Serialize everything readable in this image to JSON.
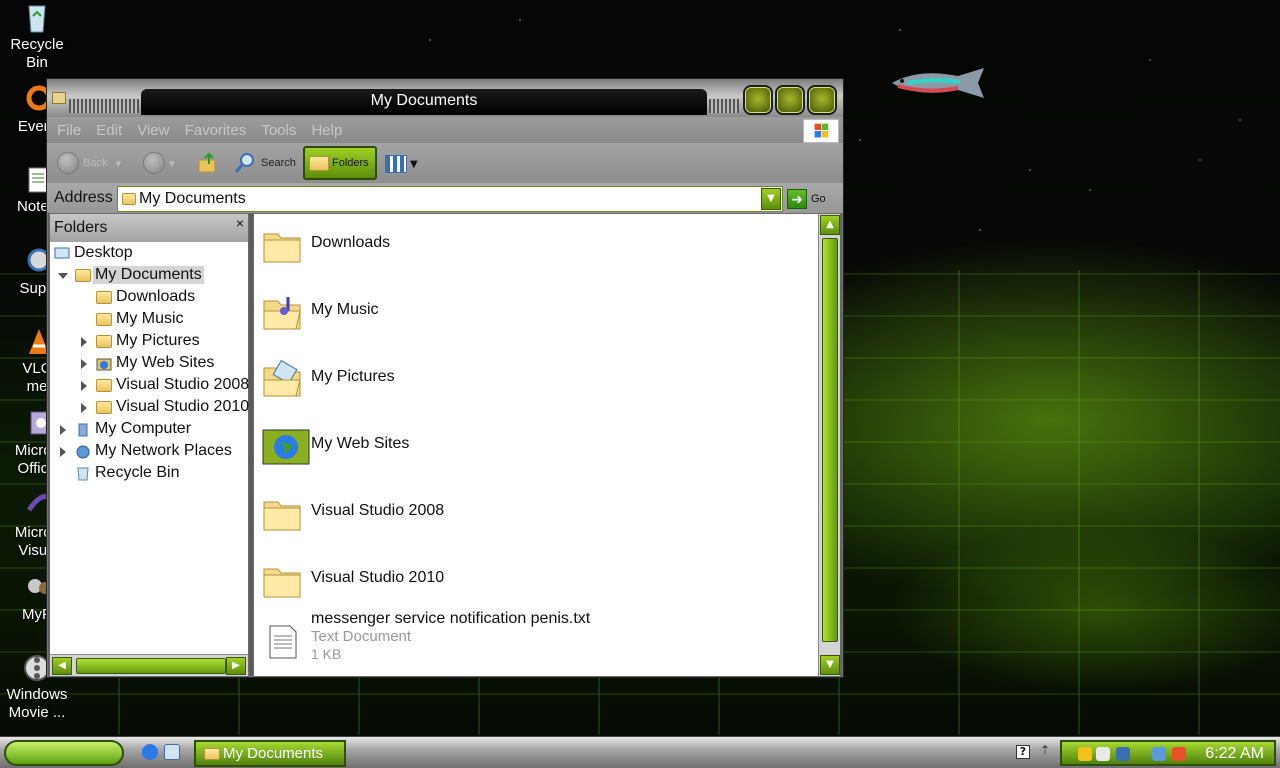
{
  "desktop": {
    "icons": [
      {
        "label": "Recycle\nBin",
        "icon": "recycle-bin-icon"
      },
      {
        "label": "Every",
        "icon": "everything-icon"
      },
      {
        "label": "Notep",
        "icon": "notepad-icon"
      },
      {
        "label": "Supe",
        "icon": "super-icon"
      },
      {
        "label": "VLC\nme",
        "icon": "vlc-icon"
      },
      {
        "label": "Micros\nOffice",
        "icon": "office-icon"
      },
      {
        "label": "Micros\nVisua",
        "icon": "visual-studio-icon"
      },
      {
        "label": "MyP",
        "icon": "mypaint-icon"
      },
      {
        "label": "Windows\nMovie ...",
        "icon": "movie-maker-icon"
      }
    ]
  },
  "window": {
    "title": "My Documents",
    "menu": [
      "File",
      "Edit",
      "View",
      "Favorites",
      "Tools",
      "Help"
    ],
    "toolbar": {
      "back": "Back",
      "search": "Search",
      "folders": "Folders"
    },
    "address": {
      "label": "Address",
      "value": "My Documents",
      "go": "Go"
    },
    "folders_pane": {
      "title": "Folders",
      "close": "×",
      "tree": [
        {
          "label": "Desktop"
        },
        {
          "label": "My Documents"
        },
        {
          "label": "Downloads"
        },
        {
          "label": "My Music"
        },
        {
          "label": "My Pictures"
        },
        {
          "label": "My Web Sites"
        },
        {
          "label": "Visual Studio 2008"
        },
        {
          "label": "Visual Studio 2010"
        },
        {
          "label": "My Computer"
        },
        {
          "label": "My Network Places"
        },
        {
          "label": "Recycle Bin"
        }
      ]
    },
    "files": [
      {
        "name": "Downloads",
        "icon": "folder-icon"
      },
      {
        "name": "My Music",
        "icon": "music-folder-icon"
      },
      {
        "name": "My Pictures",
        "icon": "pictures-folder-icon"
      },
      {
        "name": "My Web Sites",
        "icon": "web-folder-icon"
      },
      {
        "name": "Visual Studio 2008",
        "icon": "folder-icon"
      },
      {
        "name": "Visual Studio 2010",
        "icon": "folder-icon"
      },
      {
        "name": "messenger service notification penis.txt",
        "icon": "text-file-icon",
        "type": "Text Document",
        "size": "1 KB"
      }
    ]
  },
  "taskbar": {
    "task_button": "My Documents",
    "clock": "6:22 AM",
    "help": "?"
  },
  "colors": {
    "accent_green": "#7fb41a",
    "window_gray": "#8e8e8e"
  }
}
